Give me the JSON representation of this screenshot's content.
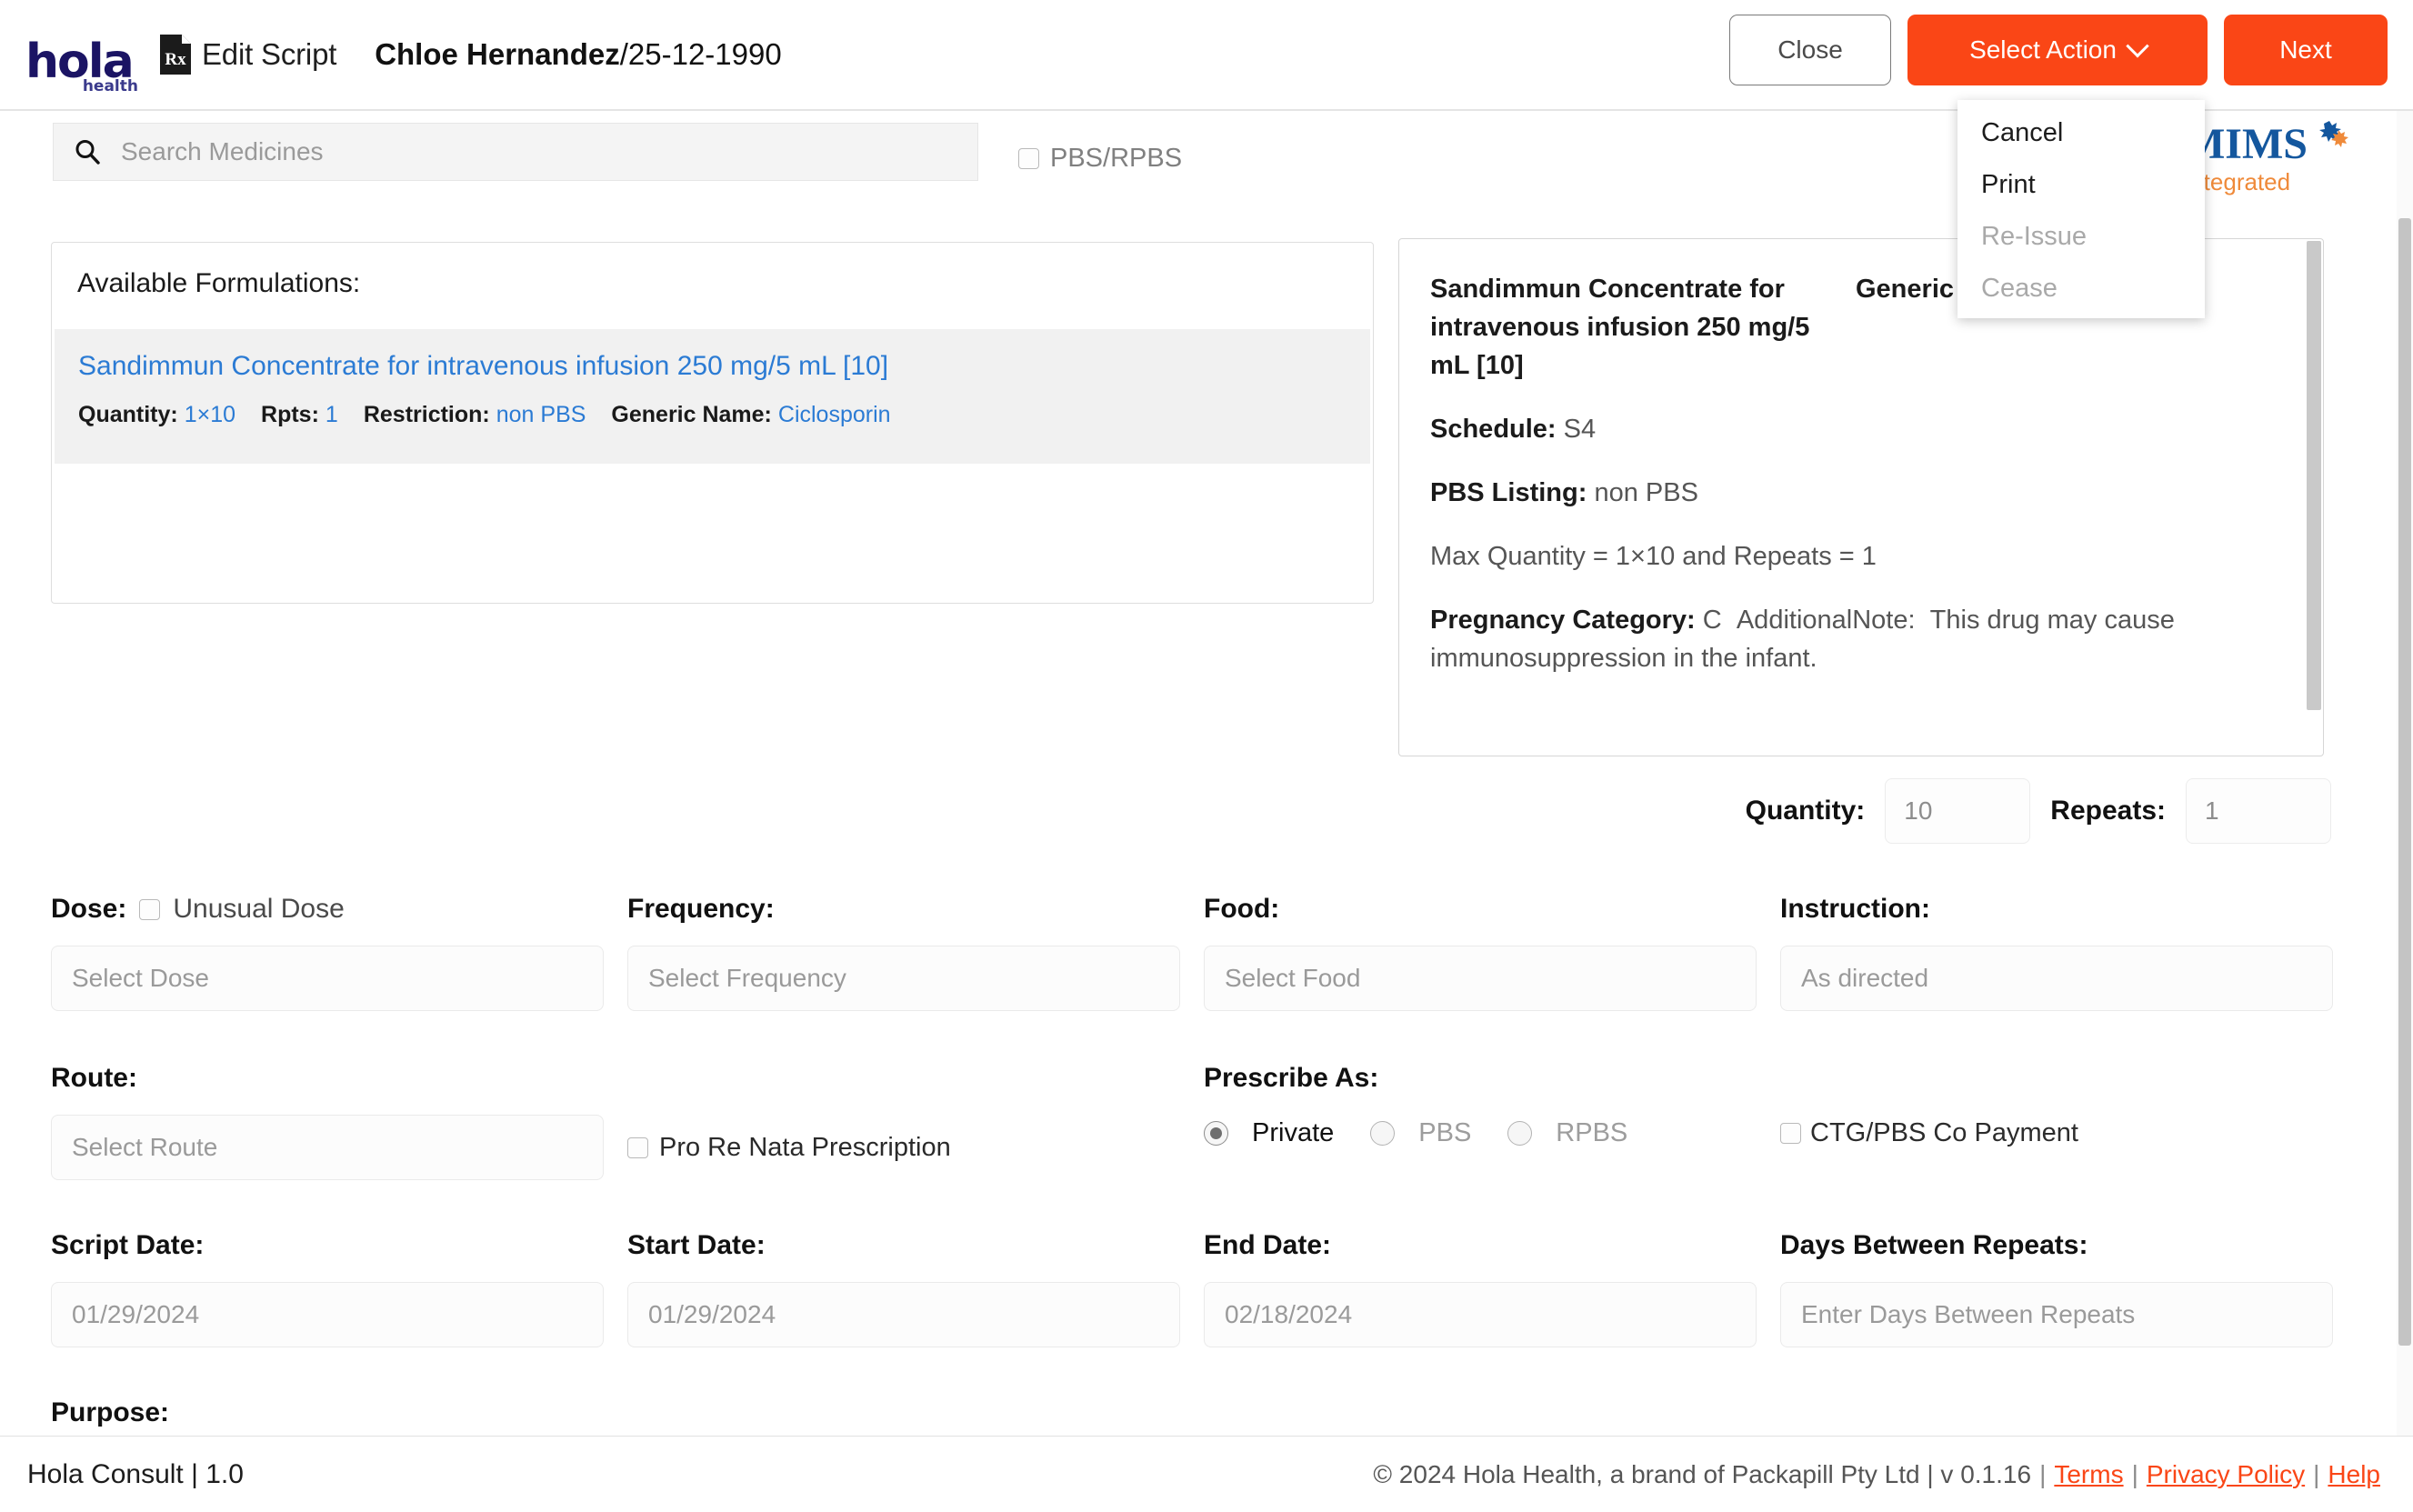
{
  "header": {
    "logo_main": "hola",
    "logo_sub": "health",
    "rx_icon": "rx-document-icon",
    "page_title": "Edit Script",
    "patient_name": "Chloe Hernandez",
    "patient_dob": "/25-12-1990",
    "close_label": "Close",
    "select_action_label": "Select Action",
    "next_label": "Next",
    "accent_color": "#FA4616"
  },
  "dropdown": {
    "items": [
      {
        "label": "Cancel",
        "disabled": false
      },
      {
        "label": "Print",
        "disabled": false
      },
      {
        "label": "Re-Issue",
        "disabled": true
      },
      {
        "label": "Cease",
        "disabled": true
      }
    ]
  },
  "search": {
    "placeholder": "Search Medicines",
    "icon": "search-icon",
    "pbs_rpbs_label": "PBS/RPBS",
    "pbs_rpbs_checked": false
  },
  "mims": {
    "title": "MIMS",
    "subtitle": "Integrated",
    "title_color": "#14579e",
    "subtitle_color": "#ef8a3a"
  },
  "formulations": {
    "title": "Available Formulations:",
    "items": [
      {
        "name": "Sandimmun Concentrate for intravenous infusion 250 mg/5 mL [10]",
        "quantity_label": "Quantity:",
        "quantity_value": "1×10",
        "rpts_label": "Rpts:",
        "rpts_value": "1",
        "restriction_label": "Restriction:",
        "restriction_value": "non PBS",
        "generic_label": "Generic Name:",
        "generic_value": "Ciclosporin"
      }
    ]
  },
  "detail": {
    "drug_name": "Sandimmun Concentrate for intravenous infusion 250 mg/5 mL [10]",
    "generic_label": "Generic Name:",
    "generic_value": "Ciclosporin",
    "schedule_label": "Schedule:",
    "schedule_value": "S4",
    "pbs_listing_label": "PBS Listing:",
    "pbs_listing_value": "non PBS",
    "max_quantity_text": "Max Quantity = 1×10 and Repeats = 1",
    "pregnancy_label": "Pregnancy Category:",
    "pregnancy_value": "C",
    "additional_note_label": "AdditionalNote:",
    "additional_note_value": "This drug may cause immunosuppression in the infant."
  },
  "quantity_row": {
    "quantity_label": "Quantity:",
    "quantity_value": "10",
    "repeats_label": "Repeats:",
    "repeats_value": "1"
  },
  "form": {
    "dose_label": "Dose:",
    "unusual_dose_label": "Unusual Dose",
    "unusual_dose_checked": false,
    "dose_placeholder": "Select Dose",
    "frequency_label": "Frequency:",
    "frequency_placeholder": "Select Frequency",
    "food_label": "Food:",
    "food_placeholder": "Select Food",
    "instruction_label": "Instruction:",
    "instruction_placeholder": "As directed",
    "route_label": "Route:",
    "route_placeholder": "Select Route",
    "prn_label": "Pro Re Nata Prescription",
    "prn_checked": false,
    "prescribe_as_label": "Prescribe As:",
    "prescribe_options": [
      {
        "label": "Private",
        "selected": true,
        "disabled": false
      },
      {
        "label": "PBS",
        "selected": false,
        "disabled": true
      },
      {
        "label": "RPBS",
        "selected": false,
        "disabled": true
      }
    ],
    "ctg_label": "CTG/PBS Co Payment",
    "ctg_checked": false,
    "script_date_label": "Script Date:",
    "script_date_value": "01/29/2024",
    "start_date_label": "Start Date:",
    "start_date_value": "01/29/2024",
    "end_date_label": "End Date:",
    "end_date_value": "02/18/2024",
    "days_between_repeats_label": "Days Between Repeats:",
    "days_between_repeats_placeholder": "Enter Days Between Repeats",
    "purpose_label": "Purpose:"
  },
  "footer": {
    "left": "Hola Consult | 1.0",
    "copyright": "© 2024 Hola Health, a brand of Packapill Pty Ltd | v 0.1.16",
    "terms": "Terms",
    "privacy": "Privacy Policy",
    "help": "Help"
  }
}
